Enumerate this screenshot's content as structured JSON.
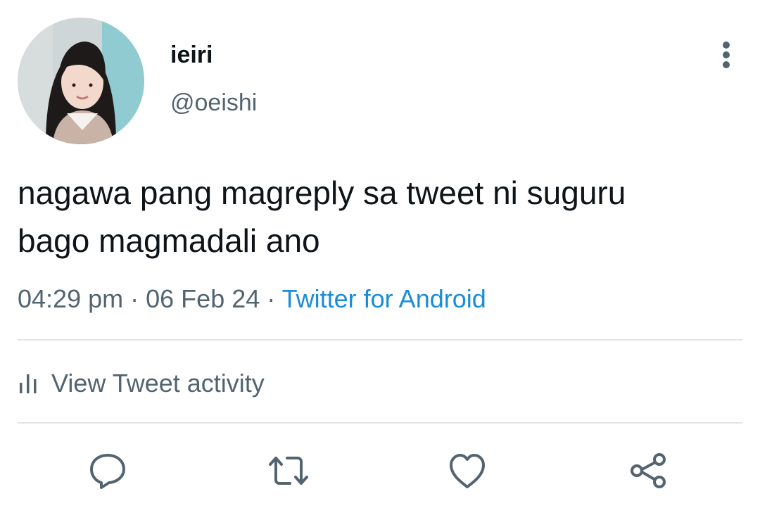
{
  "tweet": {
    "author": {
      "display_name": "ieiri",
      "handle": "@oeishi",
      "avatar_icon": "profile-photo"
    },
    "text_line1": "nagawa pang magreply sa tweet ni suguru",
    "text_line2": "bago magmadali ano",
    "time": "04:29 pm",
    "separator": "·",
    "date": "06 Feb 24",
    "source": "Twitter for Android"
  },
  "activity": {
    "label": "View Tweet activity",
    "icon": "bar-chart-icon"
  },
  "actions": [
    {
      "name": "reply",
      "icon": "reply-icon"
    },
    {
      "name": "retweet",
      "icon": "retweet-icon"
    },
    {
      "name": "like",
      "icon": "heart-icon"
    },
    {
      "name": "share",
      "icon": "share-icon"
    }
  ],
  "colors": {
    "text": "#0f1419",
    "secondary": "#536471",
    "link": "#1a8cd8",
    "divider": "#e1e4e7"
  }
}
